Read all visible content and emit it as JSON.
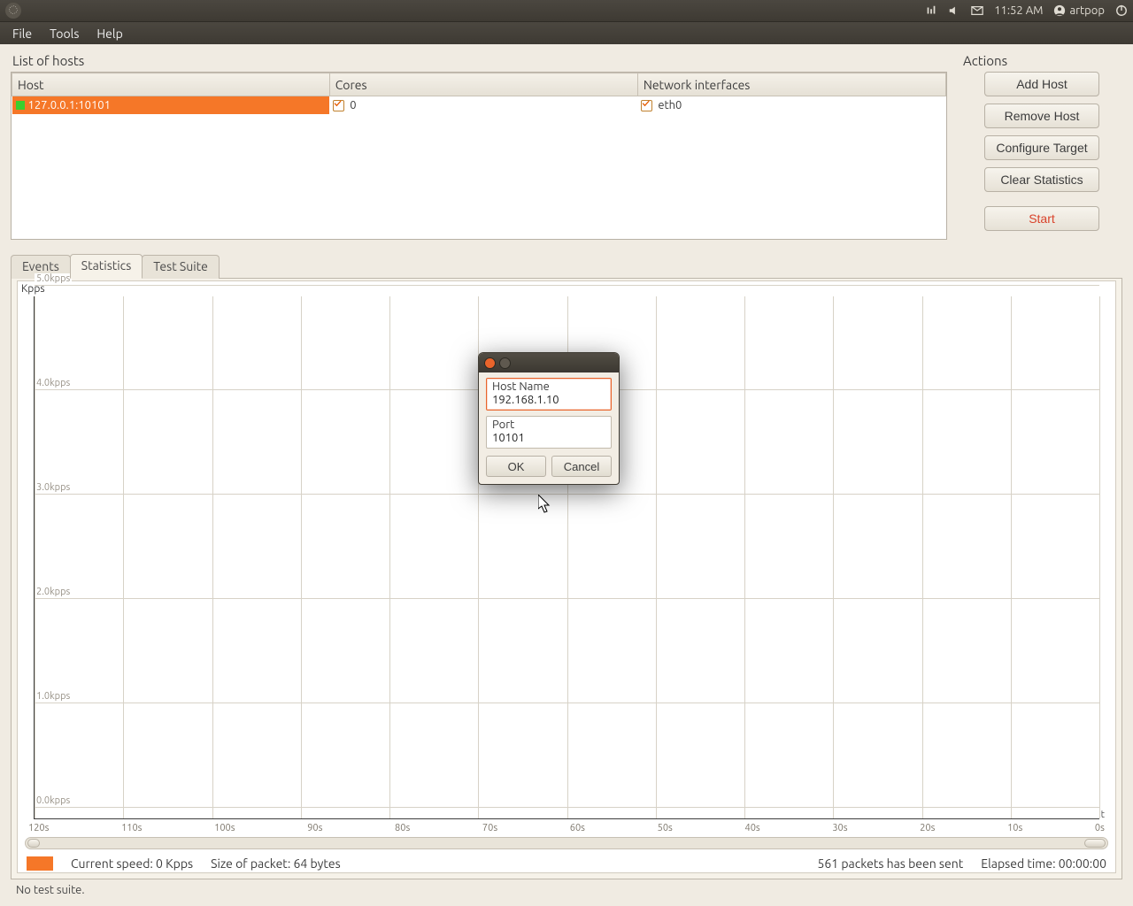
{
  "system": {
    "time": "11:52 AM",
    "username": "artpop"
  },
  "menu": {
    "file": "File",
    "tools": "Tools",
    "help": "Help"
  },
  "hosts": {
    "title": "List of hosts",
    "columns": {
      "host": "Host",
      "cores": "Cores",
      "nic": "Network interfaces"
    },
    "rows": [
      {
        "host": "127.0.0.1:10101",
        "core": "0",
        "nic": "eth0"
      }
    ]
  },
  "actions": {
    "title": "Actions",
    "add": "Add Host",
    "remove": "Remove Host",
    "configure": "Configure Target",
    "clear": "Clear Statistics",
    "start": "Start"
  },
  "tabs": {
    "events": "Events",
    "statistics": "Statistics",
    "testsuite": "Test Suite"
  },
  "chart": {
    "ylabel": "Kpps",
    "tlabel": "t"
  },
  "chart_data": {
    "type": "line",
    "title": "",
    "xlabel": "t",
    "ylabel": "Kpps",
    "ylim": [
      0,
      5
    ],
    "yticks": [
      "0.0kpps",
      "1.0kpps",
      "2.0kpps",
      "3.0kpps",
      "4.0kpps",
      "5.0kpps"
    ],
    "xticks": [
      "120s",
      "110s",
      "100s",
      "90s",
      "80s",
      "70s",
      "60s",
      "50s",
      "40s",
      "30s",
      "20s",
      "10s",
      "0s"
    ],
    "series": [
      {
        "name": "Current speed",
        "color": "#f57728",
        "values": []
      }
    ]
  },
  "footer": {
    "speed": "Current speed: 0 Kpps",
    "packet": "Size of packet: 64 bytes",
    "sent": "561 packets has been sent",
    "elapsed": "Elapsed time: 00:00:00"
  },
  "status": "No test suite.",
  "dialog": {
    "hostname_label": "Host Name",
    "hostname_value": "192.168.1.10",
    "port_label": "Port",
    "port_value": "10101",
    "ok": "OK",
    "cancel": "Cancel"
  }
}
